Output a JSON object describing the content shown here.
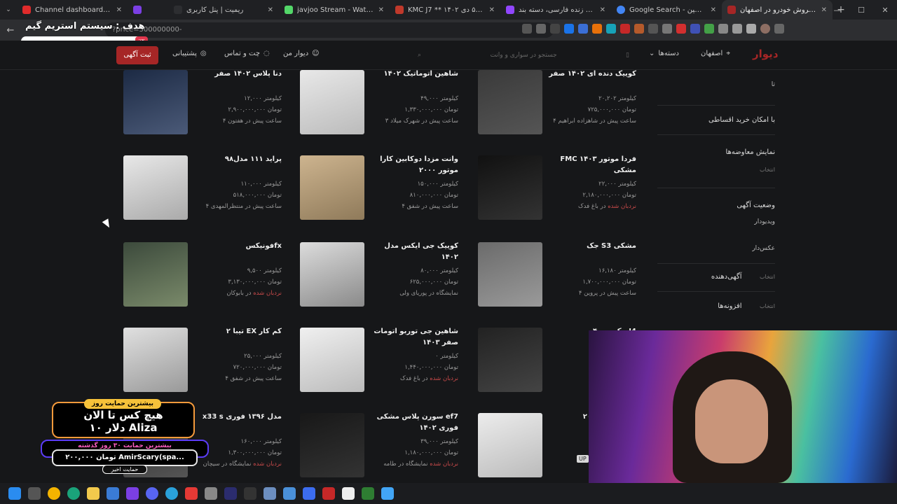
{
  "browser": {
    "tabs": [
      {
        "title": "Channel dashboard - YouTube",
        "color": "#e02b2b"
      },
      {
        "title": "",
        "color": "#7b3fe4"
      },
      {
        "title": "ریمیت | پنل کاربری",
        "color": "#2d2e31"
      },
      {
        "title": "javjoo Stream - Watch Live on",
        "color": "#53d769"
      },
      {
        "title": "KMC J7 ** ۱۴۰۲ اصفهان - ۵ دی",
        "color": "#c0392b"
      },
      {
        "title": "استریم های زنده فارسی، دسته بند",
        "color": "#9146ff"
      },
      {
        "title": "Google Search - خرید ماشین",
        "color": "#4285f4"
      },
      {
        "title": "خرید و فروش خودرو در اصفهان",
        "color": "#a62626"
      }
    ],
    "active_tab": 7,
    "new_tab": "+",
    "url": "?price=500000000-",
    "window_controls": [
      "—",
      "☐",
      "✕"
    ]
  },
  "overlay": {
    "goal_text": "هدف : سیستم استریم گیم",
    "goal_percent": "٪۲",
    "goal_fraction": 0.02
  },
  "site": {
    "logo": "دیوار",
    "city": "اصفهان",
    "categories": "دسته‌ها",
    "search_placeholder": "جستجو در سواری و وانت",
    "my_divar": "دیوار من",
    "chat": "چت و تماس",
    "support": "پشتیبانی",
    "post_ad": "ثبت آگهی"
  },
  "sidebar": {
    "to_label": "تا",
    "installment": "با امکان خرید اقساطی",
    "show_exchanges": "نمایش معاوضه‌ها",
    "select": "انتخاب",
    "ad_status": "وضعیت آگهی",
    "has_video": "ویدیودار",
    "has_photo": "عکس‌دار",
    "advertiser": "آگهی‌دهنده",
    "advertiser_select": "انتخاب",
    "addons": "افزونه‌ها",
    "addons_select": "انتخاب"
  },
  "listings": [
    {
      "title": "کوییک دنده ای ۱۴۰۲ صفر",
      "km": "۲۰,۲۰۲ کیلومتر",
      "price": "۷۲۵,۰۰۰,۰۰۰ تومان",
      "meta": "۴ ساعت پیش در شاهزاده ابراهیم",
      "ladder": ""
    },
    {
      "title": "شاهین اتوماتیک ۱۴۰۲",
      "km": "۴۹,۰۰۰ کیلومتر",
      "price": "۱,۳۳۰,۰۰۰,۰۰۰ تومان",
      "meta": "۳ ساعت پیش در شهرک میلاد",
      "ladder": ""
    },
    {
      "title": "دنا پلاس ۱۴۰۲ صفر",
      "km": "۱۲,۰۰۰ کیلومتر",
      "price": "۲,۹۰۰,۰۰۰,۰۰۰ تومان",
      "meta": "۴ ساعت پیش در هفتون",
      "ladder": ""
    },
    {
      "title": "FMC فردا موتور ۱۴۰۳ مشکی",
      "km": "۲۲,۰۰۰ کیلومتر",
      "price": "۲,۱۸۰,۰۰۰,۰۰۰ تومان",
      "meta": "در باغ فدک",
      "ladder": "نردبان شده"
    },
    {
      "title": "وانت مزدا دوکابین کارا موتور ۲۰۰۰",
      "km": "۱۵۰,۰۰۰ کیلومتر",
      "price": "۸۱۰,۰۰۰,۰۰۰ تومان",
      "meta": "۴ ساعت پیش در شفق",
      "ladder": ""
    },
    {
      "title": "پراید ۱۱۱ مدل۹۸",
      "km": "۱۱۰,۰۰۰ کیلومتر",
      "price": "۵۱۸,۰۰۰,۰۰۰ تومان",
      "meta": "۴ ساعت پیش در منتظرالمهدی",
      "ladder": ""
    },
    {
      "title": "جک S3 مشکی",
      "km": "۱۶,۱۸۰ کیلومتر",
      "price": "۱,۷۰۰,۰۰۰,۰۰۰ تومان",
      "meta": "۴ ساعت پیش در پروین",
      "ladder": ""
    },
    {
      "title": "کوییک جی ایکس مدل ۱۴۰۲",
      "km": "۸۰,۰۰۰ کیلومتر",
      "price": "۶۲۵,۰۰۰,۰۰۰ تومان",
      "meta": "نمایشگاه در پوریای ولی",
      "ladder": ""
    },
    {
      "title": "فونیکسfx",
      "km": "۹,۵۰۰ کیلومتر",
      "price": "۳,۱۳۰,۰۰۰,۰۰۰ تومان",
      "meta": "در بابوکان",
      "ladder": "نردبان شده"
    },
    {
      "title": "جک جی ۴ J4",
      "km": "",
      "price": "",
      "meta": "اصفهان",
      "ladder": ""
    },
    {
      "title": "شاهین جی توربو اتومات صفر ۱۴۰۳",
      "km": "۰ کیلومتر",
      "price": "۱,۴۴۰,۰۰۰,۰۰۰ تومان",
      "meta": "در باغ فدک",
      "ladder": "نردبان شده"
    },
    {
      "title": "تیبا ۲ EX کم کار",
      "km": "۲۵,۰۰۰ کیلومتر",
      "price": "۷۲۰,۰۰۰,۰۰۰ تومان",
      "meta": "۴ ساعت پیش در شفق",
      "ladder": ""
    },
    {
      "title": "۲۰۷ صفر )و کم",
      "km": "",
      "price": "",
      "meta": "",
      "ladder": ""
    },
    {
      "title": "سورن پلاس مشکی ef7 ۱۴۰۲ فوری",
      "km": "۳۹,۰۰۰ کیلومتر",
      "price": "۱,۱۸۰,۰۰۰,۰۰۰ تومان",
      "meta": "نمایشگاه در طامه",
      "ladder": "نردبان شده"
    },
    {
      "title": "x33 s مدل ۱۳۹۶ فوری",
      "km": "۱۶۰,۰۰۰ کیلومتر",
      "price": "۱,۳۰۰,۰۰۰,۰۰۰ تومان",
      "meta": "نمایشگاه در سیچان",
      "ladder": "نردبان شده"
    }
  ],
  "donation": {
    "top_label": "بیشترین حمایت روز",
    "line1": "هیچ کس تا الان",
    "line2": "۱۰ دلار Aliza",
    "line3": "بیشترین حمایت ۳۰ روز گذشته",
    "line4": "۲۰۰,۰۰۰ تومان AmirScary(spa...",
    "bottom_label": "حمایت اخیر"
  },
  "badge_up": "UP"
}
